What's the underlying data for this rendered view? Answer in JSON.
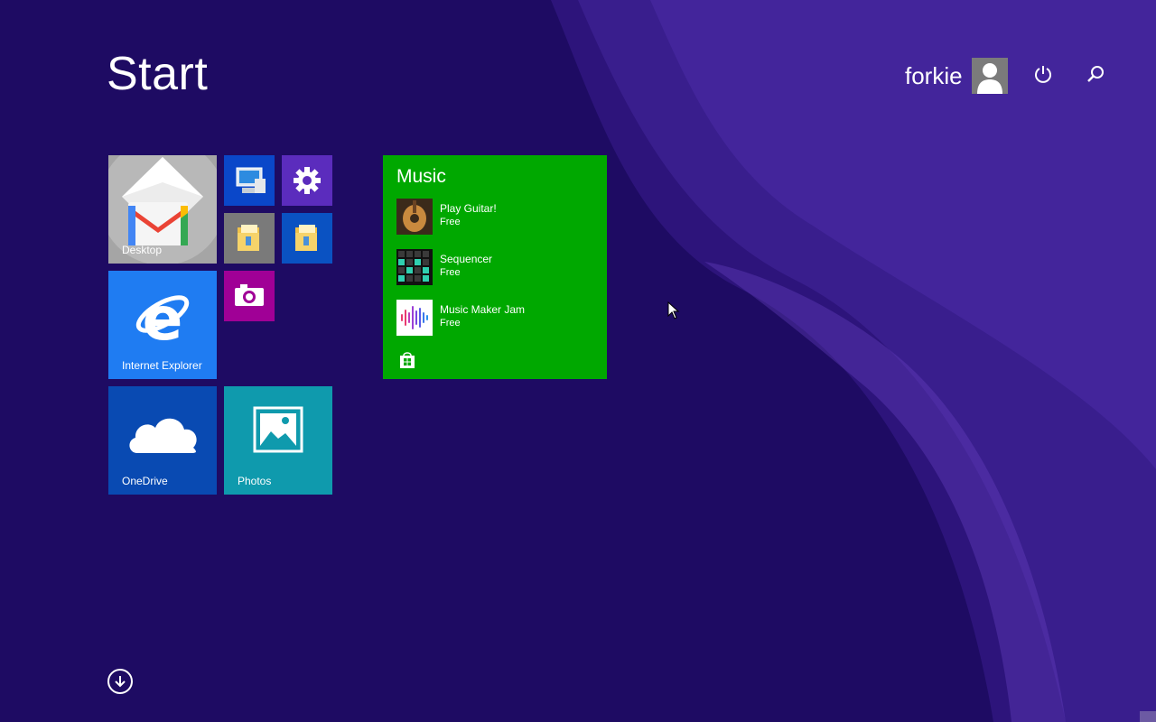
{
  "header": {
    "title": "Start",
    "user_name": "forkie",
    "avatar_icon": "user-avatar-icon",
    "power_icon": "power-icon",
    "search_icon": "search-icon"
  },
  "tiles": {
    "desktop": {
      "label": "Desktop",
      "icon": "gmail-icon"
    },
    "this_pc": {
      "icon": "computer-icon"
    },
    "settings": {
      "icon": "gear-icon"
    },
    "file_explorer_1": {
      "icon": "folder-icon"
    },
    "file_explorer_2": {
      "icon": "folder-icon"
    },
    "camera": {
      "icon": "camera-icon"
    },
    "internet_explorer": {
      "label": "Internet Explorer",
      "icon": "internet-explorer-icon"
    },
    "onedrive": {
      "label": "OneDrive",
      "icon": "cloud-icon"
    },
    "photos": {
      "label": "Photos",
      "icon": "photos-icon"
    },
    "music": {
      "title": "Music",
      "items": [
        {
          "name": "Play Guitar!",
          "price": "Free",
          "icon": "guitar-icon"
        },
        {
          "name": "Sequencer",
          "price": "Free",
          "icon": "sequencer-icon"
        },
        {
          "name": "Music Maker Jam",
          "price": "Free",
          "icon": "soundwave-icon"
        }
      ],
      "store_icon": "store-icon"
    }
  },
  "footer": {
    "all_apps_icon": "arrow-down-circle-icon"
  },
  "colors": {
    "background": "#1e0b63",
    "music_tile": "#00a800",
    "ie_tile": "#1f7cf2",
    "onedrive_tile": "#094ab2",
    "photos_tile": "#0f9aad",
    "settings_tile": "#5b2cbd",
    "camera_tile": "#a00096"
  }
}
